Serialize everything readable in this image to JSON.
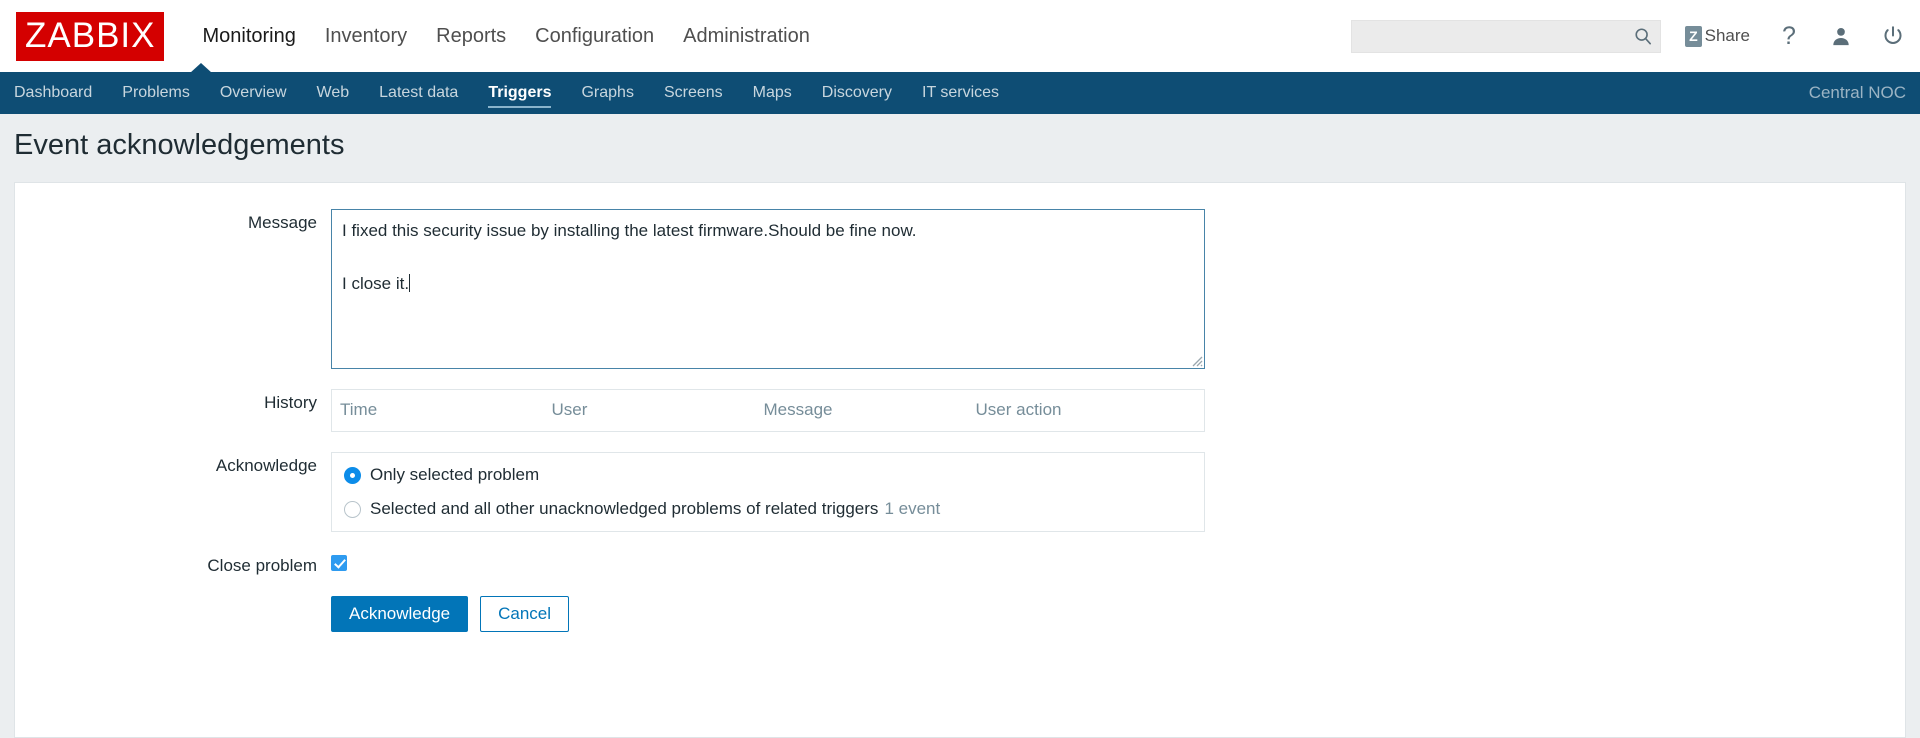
{
  "header": {
    "logo_text": "ZABBIX",
    "menu": [
      {
        "label": "Monitoring",
        "selected": true
      },
      {
        "label": "Inventory",
        "selected": false
      },
      {
        "label": "Reports",
        "selected": false
      },
      {
        "label": "Configuration",
        "selected": false
      },
      {
        "label": "Administration",
        "selected": false
      }
    ],
    "search": {
      "value": "",
      "placeholder": "",
      "icon": "search-icon"
    },
    "share": {
      "badge": "Z",
      "label": "Share"
    },
    "help_icon": "?",
    "user_icon": "user-icon",
    "power_icon": "power-icon"
  },
  "subnav": {
    "items": [
      {
        "label": "Dashboard",
        "active": false
      },
      {
        "label": "Problems",
        "active": false
      },
      {
        "label": "Overview",
        "active": false
      },
      {
        "label": "Web",
        "active": false
      },
      {
        "label": "Latest data",
        "active": false
      },
      {
        "label": "Triggers",
        "active": true
      },
      {
        "label": "Graphs",
        "active": false
      },
      {
        "label": "Screens",
        "active": false
      },
      {
        "label": "Maps",
        "active": false
      },
      {
        "label": "Discovery",
        "active": false
      },
      {
        "label": "IT services",
        "active": false
      }
    ],
    "right_label": "Central NOC"
  },
  "page": {
    "title": "Event acknowledgements"
  },
  "form": {
    "message": {
      "label": "Message",
      "line1": "I fixed this security issue by installing the latest firmware.Should be fine now.",
      "line2": "I close it.",
      "placeholder": ""
    },
    "history": {
      "label": "History",
      "columns": [
        "Time",
        "User",
        "Message",
        "User action"
      ],
      "rows": []
    },
    "acknowledge": {
      "label": "Acknowledge",
      "options": [
        {
          "label": "Only selected problem",
          "selected": true,
          "suffix": ""
        },
        {
          "label": "Selected and all other unacknowledged problems of related triggers",
          "selected": false,
          "suffix": "1 event"
        }
      ]
    },
    "close_problem": {
      "label": "Close problem",
      "checked": true
    },
    "buttons": {
      "submit": "Acknowledge",
      "cancel": "Cancel"
    }
  },
  "colors": {
    "brand_red": "#d40000",
    "nav_blue": "#0e4d74",
    "accent_blue": "#0275b8",
    "radio_blue": "#0c8ce9",
    "muted": "#768d99"
  }
}
